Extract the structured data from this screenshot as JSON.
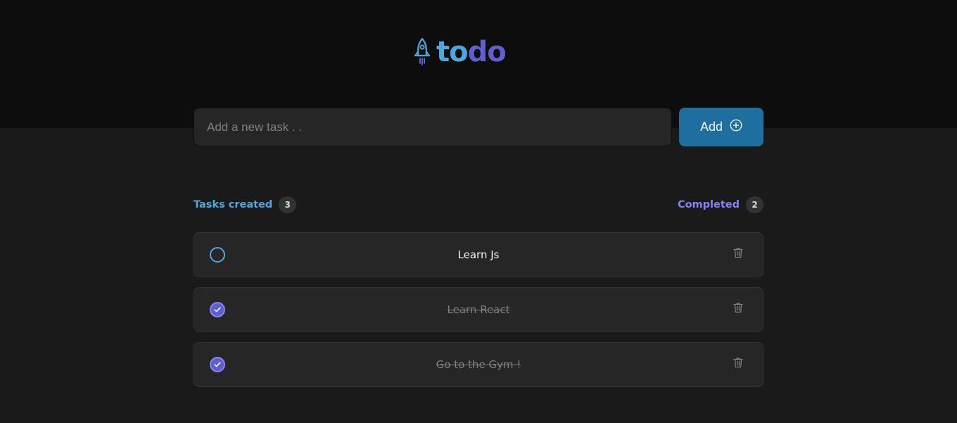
{
  "app": {
    "logo_prefix": "to",
    "logo_suffix": "do",
    "logo_icon": "rocket-icon"
  },
  "new_task": {
    "placeholder": "Add a new task . .",
    "value": ""
  },
  "add_button": {
    "label": "Add",
    "icon": "plus-circle-icon"
  },
  "stats": {
    "created_label": "Tasks created",
    "created_count": "3",
    "completed_label": "Completed",
    "completed_count": "2"
  },
  "tasks": [
    {
      "text": "Learn Js",
      "completed": false
    },
    {
      "text": "Learn React",
      "completed": true
    },
    {
      "text": "Go to the Gym !",
      "completed": true
    }
  ],
  "colors": {
    "blue": "#4ea8de",
    "purple": "#5e60ce",
    "purple_light": "#8284fa",
    "button": "#1e6f9f",
    "header_bg": "#0d0d0d",
    "body_bg": "#1a1a1a",
    "card_bg": "#262626"
  }
}
